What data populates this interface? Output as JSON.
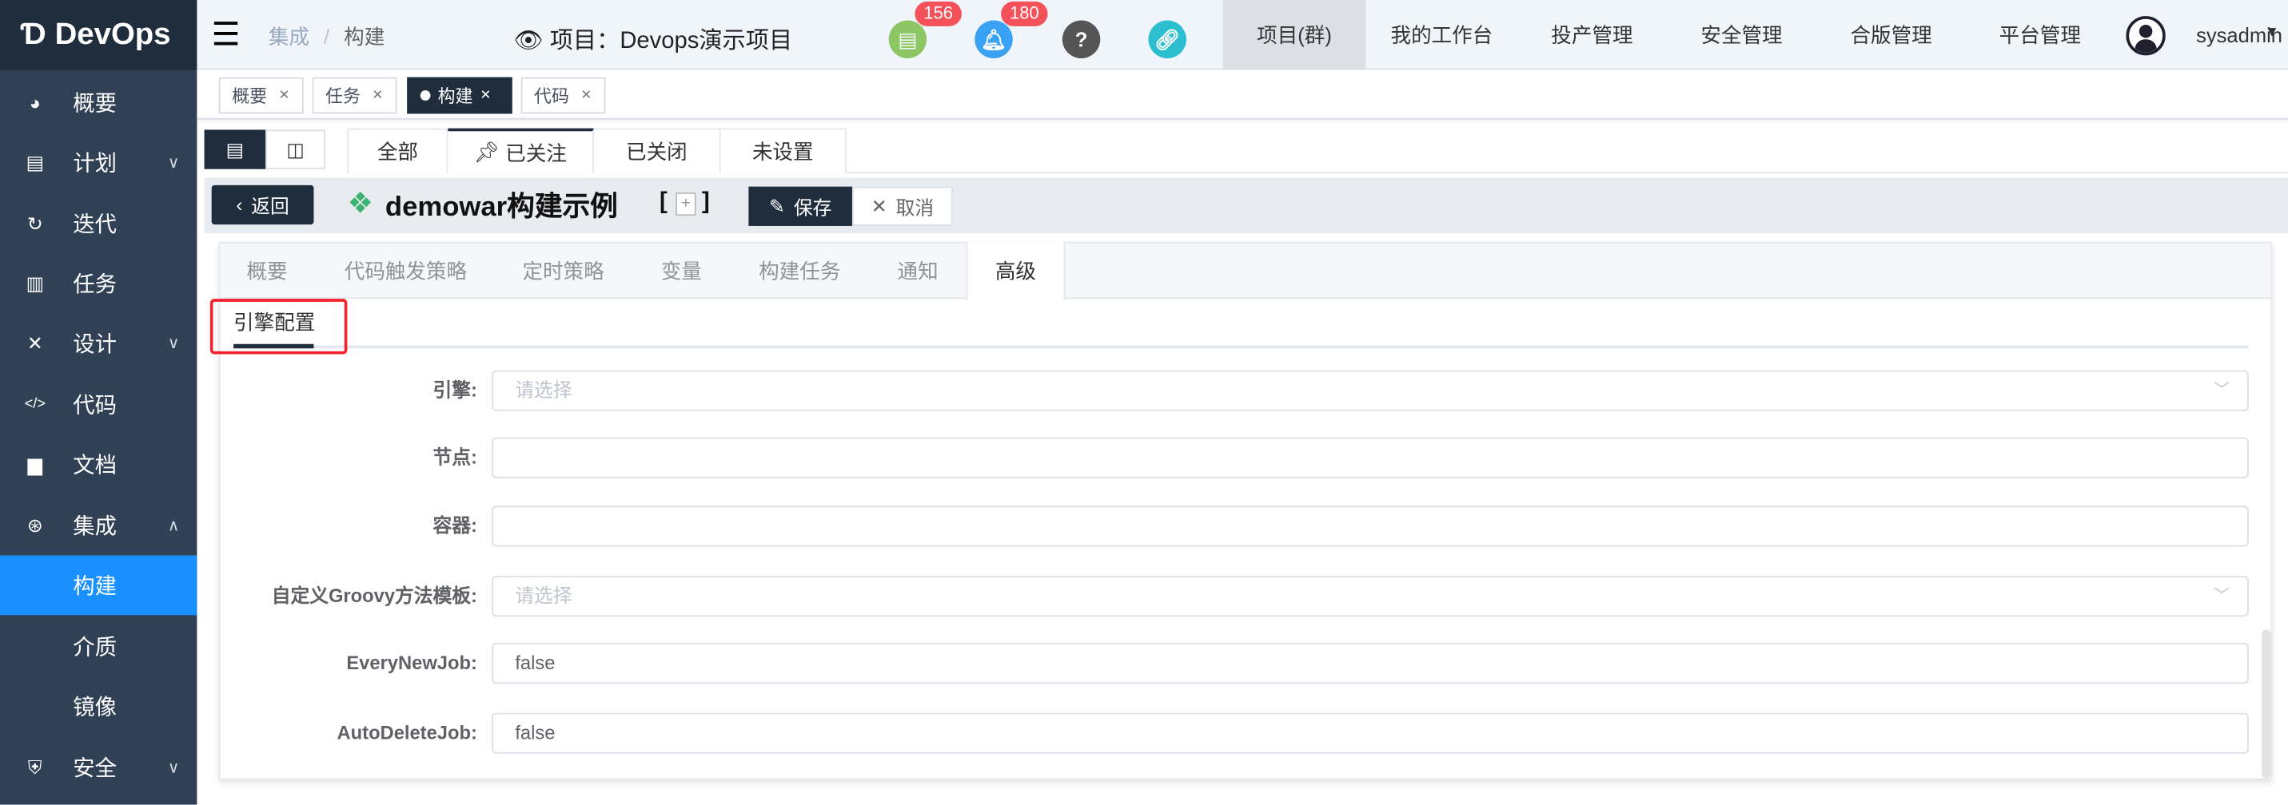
{
  "app": {
    "logo": "DevOps"
  },
  "sidebar": {
    "items": [
      {
        "label": "概要",
        "icon": "dashboard-icon",
        "y": 0
      },
      {
        "label": "计划",
        "icon": "plan-icon"
      },
      {
        "label": "迭代",
        "icon": "iteration-icon"
      },
      {
        "label": "任务",
        "icon": "task-icon"
      },
      {
        "label": "设计",
        "icon": "design-icon"
      },
      {
        "label": "代码",
        "icon": "code-icon"
      },
      {
        "label": "文档",
        "icon": "document-icon"
      },
      {
        "label": "集成",
        "icon": "integration-icon"
      },
      {
        "label": "构建"
      },
      {
        "label": "介质"
      },
      {
        "label": "镜像"
      },
      {
        "label": "安全",
        "icon": "shield-icon"
      }
    ]
  },
  "header": {
    "breadcrumb": [
      "集成",
      "构建"
    ],
    "breadcrumb_sep": "/",
    "project": "项目：Devops演示项目",
    "badges": {
      "docs": "156",
      "notifications": "180"
    },
    "help": "?",
    "nav": [
      "项目(群)",
      "我的工作台",
      "投产管理",
      "安全管理",
      "合版管理",
      "平台管理"
    ],
    "user": "sysadmin"
  },
  "tags": [
    {
      "label": "概要"
    },
    {
      "label": "任务"
    },
    {
      "label": "构建"
    },
    {
      "label": "代码"
    }
  ],
  "filter_tabs": [
    "全部",
    "已关注",
    "已关闭",
    "未设置"
  ],
  "toolbar": {
    "back": "返回",
    "title": "demowar构建示例",
    "bracket_open": "[",
    "bracket_close": "]",
    "plus": "+",
    "save": "保存",
    "cancel": "取消"
  },
  "config_tabs": [
    "概要",
    "代码触发策略",
    "定时策略",
    "变量",
    "构建任务",
    "通知",
    "高级"
  ],
  "sub_tab": "引擎配置",
  "form": [
    {
      "label": "引擎:",
      "value": "",
      "placeholder": "请选择",
      "type": "select"
    },
    {
      "label": "节点:",
      "value": ""
    },
    {
      "label": "容器:",
      "value": ""
    },
    {
      "label": "自定义Groovy方法模板:",
      "value": "",
      "placeholder": "请选择",
      "type": "select"
    },
    {
      "label": "EveryNewJob:",
      "value": "false"
    },
    {
      "label": "AutoDeleteJob:",
      "value": "false"
    }
  ],
  "colors": {
    "sidebar": "#304156",
    "active": "#1890ff",
    "dark": "#1f2d3d",
    "highlight": "#f5222d"
  }
}
